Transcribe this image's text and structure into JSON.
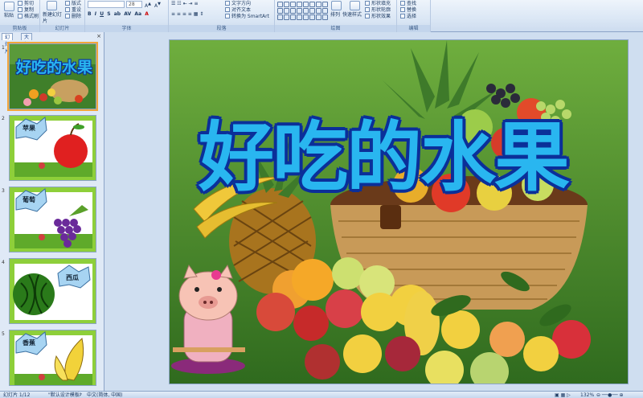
{
  "ribbon": {
    "clipboard": {
      "title": "剪贴板",
      "paste": "粘贴",
      "copy": "复制",
      "format_painter": "格式刷",
      "cut": "剪切"
    },
    "slides": {
      "title": "幻灯片",
      "new_slide": "新建幻灯片",
      "layout": "版式",
      "reset": "重设",
      "delete": "删除"
    },
    "font": {
      "title": "字体",
      "font_size": "28"
    },
    "paragraph": {
      "title": "段落",
      "text_direction": "文字方向",
      "align_text": "对齐文本",
      "smartart": "转换为 SmartArt"
    },
    "drawing": {
      "title": "绘图",
      "arrange": "排列",
      "quick_styles": "快速样式",
      "shape_fill": "形状填充",
      "shape_outline": "形状轮廓",
      "shape_effects": "形状效果"
    },
    "editing": {
      "title": "编辑",
      "find": "查找",
      "replace": "替换",
      "select": "选择"
    }
  },
  "panel": {
    "tab_slides": "幻灯片",
    "tab_outline": "大纲",
    "close": "×",
    "thumbnails": [
      {
        "number": "1",
        "label": "好吃的水果",
        "selected": true
      },
      {
        "number": "2",
        "label": "苹果"
      },
      {
        "number": "3",
        "label": "葡萄"
      },
      {
        "number": "4",
        "label": "西瓜"
      },
      {
        "number": "5",
        "label": "香蕉"
      }
    ]
  },
  "slide": {
    "title": "好吃的水果"
  },
  "status": {
    "slide_counter": "幻灯片 1/12",
    "theme": "\"默认设计模板\"",
    "language": "中文(简体, 中国)",
    "zoom": "132%"
  },
  "colors": {
    "title_fill": "#29b6f0",
    "title_outline": "#0b2f99",
    "selection": "#f2a63a",
    "ribbon_text": "#15428b"
  }
}
